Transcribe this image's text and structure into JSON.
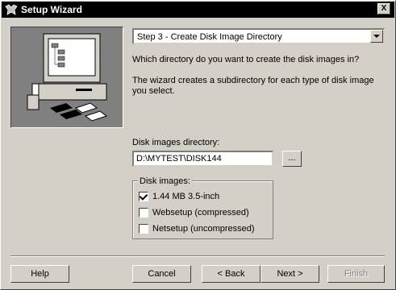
{
  "window": {
    "title": "Setup Wizard",
    "close_label": "X"
  },
  "step_select": {
    "value": "Step 3 - Create Disk Image Directory"
  },
  "prompt": {
    "question": "Which directory do you want to create the disk images in?",
    "info_line1": "The wizard creates a subdirectory for each type of disk image",
    "info_line2": "you select."
  },
  "directory": {
    "label": "Disk images directory:",
    "value": "D:\\MYTEST\\DISK144",
    "browse_label": "..."
  },
  "disk_images": {
    "label": "Disk images:",
    "options": [
      {
        "label": "1.44 MB 3.5-inch",
        "checked": true
      },
      {
        "label": "Websetup (compressed)",
        "checked": false
      },
      {
        "label": "Netsetup (uncompressed)",
        "checked": false
      }
    ]
  },
  "buttons": {
    "help": "Help",
    "cancel": "Cancel",
    "back": "< Back",
    "next": "Next >",
    "finish": "Finish"
  }
}
